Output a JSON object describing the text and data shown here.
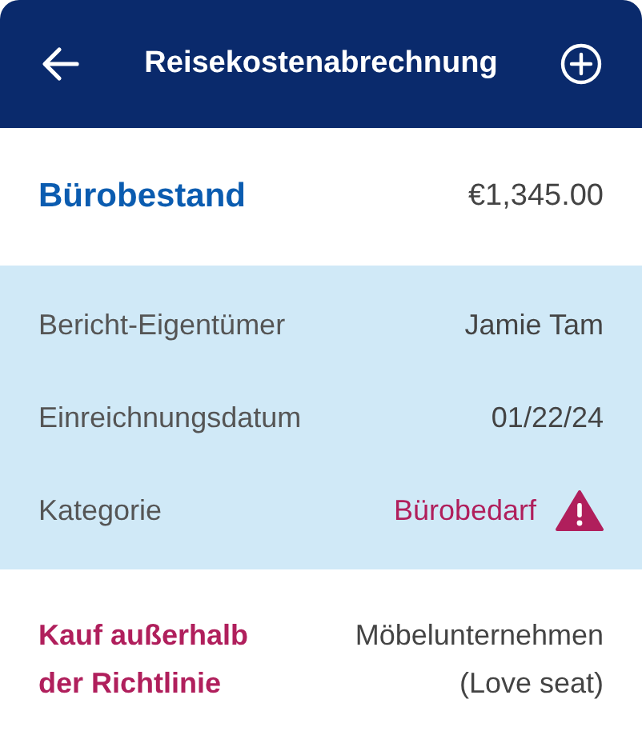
{
  "header": {
    "title": "Reisekostenabrechnung"
  },
  "summary": {
    "label": "Bürobestand",
    "amount": "€1,345.00"
  },
  "details": [
    {
      "label": "Bericht-Eigentümer",
      "value": "Jamie Tam",
      "warning": false
    },
    {
      "label": "Einreichnungsdatum",
      "value": "01/22/24",
      "warning": false
    },
    {
      "label": "Kategorie",
      "value": "Bürobedarf",
      "warning": true
    }
  ],
  "policy": {
    "label": "Kauf außerhalb der Richtlinie",
    "value": "Möbelunternehmen (Love seat)"
  }
}
